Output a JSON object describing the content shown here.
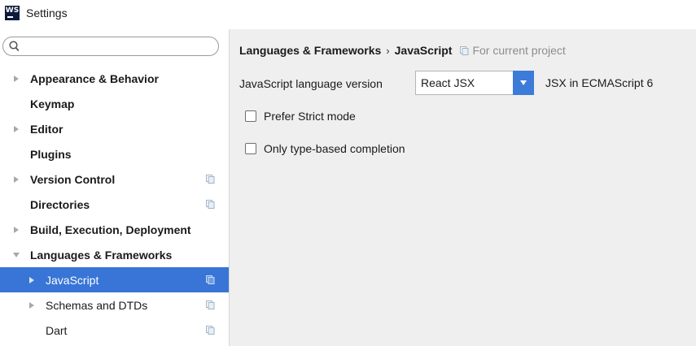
{
  "window": {
    "logo_text": "WS",
    "title": "Settings"
  },
  "search": {
    "placeholder": "",
    "value": ""
  },
  "sidebar": {
    "items": [
      {
        "label": "Appearance & Behavior",
        "expander": "collapsed",
        "project_icon": false,
        "selected": false
      },
      {
        "label": "Keymap",
        "expander": "none",
        "project_icon": false,
        "selected": false
      },
      {
        "label": "Editor",
        "expander": "collapsed",
        "project_icon": false,
        "selected": false
      },
      {
        "label": "Plugins",
        "expander": "none",
        "project_icon": false,
        "selected": false
      },
      {
        "label": "Version Control",
        "expander": "collapsed",
        "project_icon": true,
        "selected": false
      },
      {
        "label": "Directories",
        "expander": "none",
        "project_icon": true,
        "selected": false
      },
      {
        "label": "Build, Execution, Deployment",
        "expander": "collapsed",
        "project_icon": false,
        "selected": false
      },
      {
        "label": "Languages & Frameworks",
        "expander": "expanded",
        "project_icon": false,
        "selected": false
      },
      {
        "label": "JavaScript",
        "expander": "collapsed",
        "project_icon": true,
        "selected": true
      },
      {
        "label": "Schemas and DTDs",
        "expander": "collapsed",
        "project_icon": true,
        "selected": false
      },
      {
        "label": "Dart",
        "expander": "none",
        "project_icon": true,
        "selected": false
      }
    ]
  },
  "main": {
    "breadcrumb": {
      "parent": "Languages & Frameworks",
      "separator": "›",
      "current": "JavaScript"
    },
    "scope_note": "For current project",
    "language_version": {
      "label": "JavaScript language version",
      "selected": "React JSX",
      "note": "JSX in ECMAScript 6"
    },
    "options": [
      {
        "label": "Prefer Strict mode",
        "checked": false
      },
      {
        "label": "Only type-based completion",
        "checked": false
      }
    ]
  },
  "colors": {
    "selection": "#3875d6",
    "dropdown_button": "#3c7bd8",
    "panel_background": "#efefef"
  },
  "icons": {
    "app": "webstorm-logo-icon",
    "search": "search-icon",
    "project_scope": "project-scope-icon",
    "expand": "chevron-right-icon",
    "collapse": "chevron-down-icon"
  }
}
